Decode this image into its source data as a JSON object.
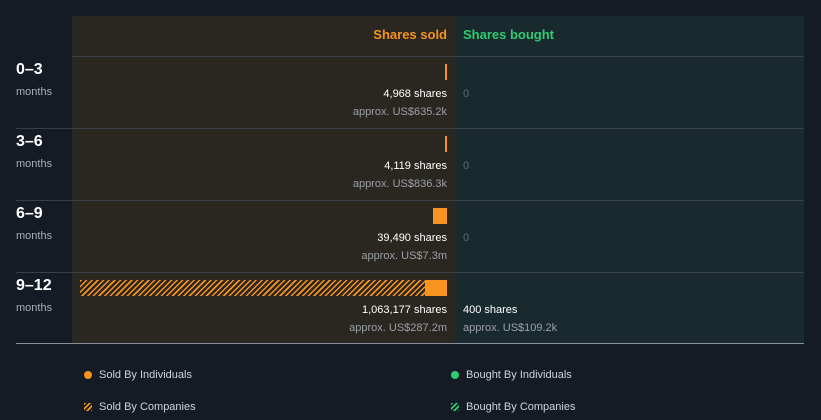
{
  "header": {
    "sold": "Shares sold",
    "bought": "Shares bought"
  },
  "colors": {
    "sold": "#f7931e",
    "bought": "#2ecc71"
  },
  "legend": {
    "sold_individuals": "Sold By Individuals",
    "bought_individuals": "Bought By Individuals",
    "sold_companies": "Sold By Companies",
    "bought_companies": "Bought By Companies"
  },
  "chart_data": {
    "type": "bar",
    "categories": [
      "0–3",
      "3–6",
      "6–9",
      "9–12"
    ],
    "unit_label": "months",
    "series": [
      {
        "name": "Sold By Individuals",
        "values": [
          4968,
          4119,
          39490,
          63177
        ]
      },
      {
        "name": "Sold By Companies",
        "values": [
          0,
          0,
          0,
          1000000
        ]
      },
      {
        "name": "Bought By Individuals",
        "values": [
          0,
          0,
          0,
          400
        ]
      },
      {
        "name": "Bought By Companies",
        "values": [
          0,
          0,
          0,
          0
        ]
      }
    ],
    "rows": [
      {
        "period": "0–3",
        "unit": "months",
        "sold_shares": "4,968 shares",
        "sold_approx": "approx. US$635.2k",
        "bought": "0",
        "bought_approx": ""
      },
      {
        "period": "3–6",
        "unit": "months",
        "sold_shares": "4,119 shares",
        "sold_approx": "approx. US$836.3k",
        "bought": "0",
        "bought_approx": ""
      },
      {
        "period": "6–9",
        "unit": "months",
        "sold_shares": "39,490 shares",
        "sold_approx": "approx. US$7.3m",
        "bought": "0",
        "bought_approx": ""
      },
      {
        "period": "9–12",
        "unit": "months",
        "sold_shares": "1,063,177 shares",
        "sold_approx": "approx. US$287.2m",
        "bought": "400 shares",
        "bought_approx": "approx. US$109.2k"
      }
    ]
  }
}
